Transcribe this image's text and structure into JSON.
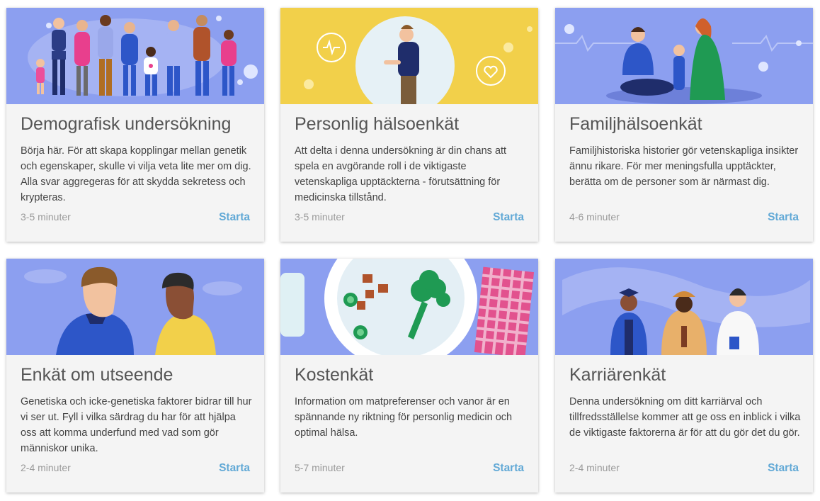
{
  "cards": [
    {
      "title": "Demografisk undersökning",
      "description": "Börja här. För att skapa kopplingar mellan genetik och egenskaper, skulle vi vilja veta lite mer om dig. Alla svar aggregeras för att skydda sekretess och krypteras.",
      "duration": "3-5 minuter",
      "action": "Starta",
      "illustration": "group-of-people-illustration",
      "bg_color": "#8c9ff0"
    },
    {
      "title": "Personlig hälsoenkät",
      "description": "Att delta i denna undersökning är din chans att spela en avgörande roll i de viktigaste vetenskapliga upptäckterna - förutsättning för medicinska tillstånd.",
      "duration": "3-5 minuter",
      "action": "Starta",
      "illustration": "person-health-illustration",
      "bg_color": "#f2d04a"
    },
    {
      "title": "Familjhälsoenkät",
      "description": "Familjhistoriska historier gör vetenskapliga insikter ännu rikare. För mer meningsfulla upptäckter, berätta om de personer som är närmast dig.",
      "duration": "4-6 minuter",
      "action": "Starta",
      "illustration": "family-illustration",
      "bg_color": "#8c9ff0"
    },
    {
      "title": "Enkät om utseende",
      "description": "Genetiska och icke-genetiska faktorer bidrar till hur vi ser ut. Fyll i vilka särdrag du har för att hjälpa oss att komma underfund med vad som gör människor unika.",
      "duration": "2-4 minuter",
      "action": "Starta",
      "illustration": "two-faces-illustration",
      "bg_color": "#8c9ff0"
    },
    {
      "title": "Kostenkät",
      "description": "Information om matpreferenser och vanor är en spännande ny riktning för personlig medicin och optimal hälsa.",
      "duration": "5-7 minuter",
      "action": "Starta",
      "illustration": "food-plate-illustration",
      "bg_color": "#8c9ff0"
    },
    {
      "title": "Karriärenkät",
      "description": "Denna undersökning om ditt karriärval och tillfredsställelse kommer att ge oss en inblick i vilka de viktigaste faktorerna är för att du gör det du gör.",
      "duration": "2-4 minuter",
      "action": "Starta",
      "illustration": "professions-illustration",
      "bg_color": "#8c9ff0"
    }
  ]
}
